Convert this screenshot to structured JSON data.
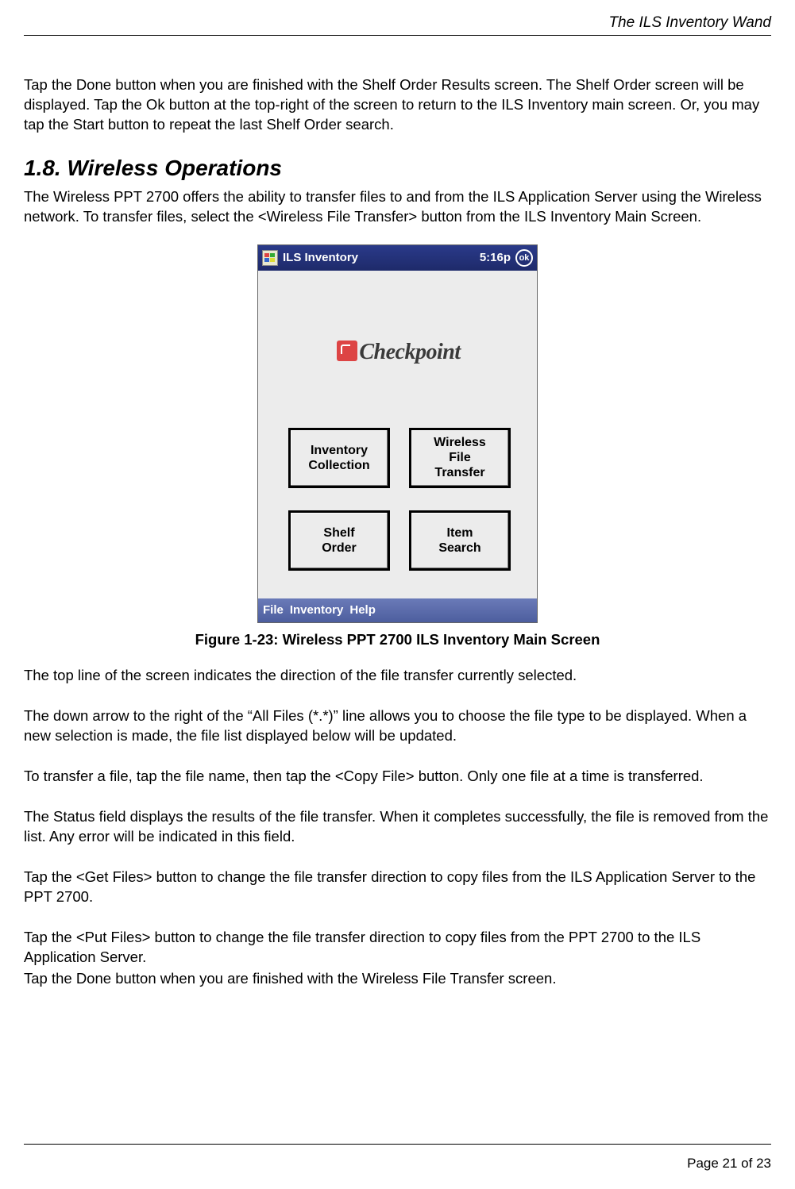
{
  "header": {
    "title": "The ILS Inventory Wand"
  },
  "paragraphs": {
    "intro1": "Tap the Done button when you are finished with the Shelf Order Results screen. The Shelf Order screen will be displayed. Tap the Ok button at the top-right of the screen to return to the ILS Inventory main screen. Or, you may tap the Start button to repeat the last Shelf Order search."
  },
  "section": {
    "heading": "1.8.  Wireless Operations",
    "intro": "The Wireless PPT 2700 offers the ability to transfer files to and from the ILS Application Server using the Wireless network. To transfer files, select the <Wireless File Transfer> button from the ILS Inventory Main Screen."
  },
  "device": {
    "titlebar": {
      "title": "ILS Inventory",
      "time": "5:16p",
      "ok": "ok"
    },
    "logo": "Checkpoint",
    "buttons": {
      "inventory": "Inventory\nCollection",
      "wireless": "Wireless\nFile\nTransfer",
      "shelf": "Shelf\nOrder",
      "item": "Item\nSearch"
    },
    "menubar": {
      "file": "File",
      "inventory": "Inventory",
      "help": "Help"
    }
  },
  "figure": {
    "caption": "Figure 1-23: Wireless PPT 2700 ILS Inventory Main Screen"
  },
  "body": {
    "p1": "The top line of the screen indicates the direction of the file transfer currently selected.",
    "p2": "The down arrow to the right of the “All Files (*.*)” line allows you to choose the file type to be displayed. When a new selection is made, the file list displayed below will be updated.",
    "p3": "To transfer a file, tap the file name, then tap the <Copy File> button. Only one file at a time is transferred.",
    "p4": "The Status field displays the results of the file transfer. When it completes successfully, the file is removed from the list. Any error will be indicated in this field.",
    "p5": "Tap the <Get Files> button to change the file transfer direction to copy files from the ILS Application Server to the PPT 2700.",
    "p6": "Tap the <Put Files> button to change the file transfer direction to copy files from the PPT 2700 to the ILS Application Server.",
    "p7": "Tap the Done button when you are finished with the Wireless File Transfer screen."
  },
  "footer": {
    "page": "Page 21 of 23"
  }
}
